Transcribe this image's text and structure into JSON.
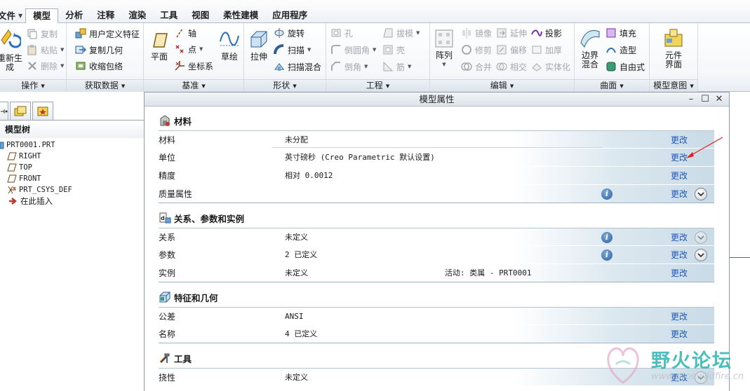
{
  "tabs": [
    {
      "label": "文件",
      "key": "file"
    },
    {
      "label": "模型",
      "key": "model"
    },
    {
      "label": "分析",
      "key": "analysis"
    },
    {
      "label": "注释",
      "key": "annotate"
    },
    {
      "label": "渲染",
      "key": "render"
    },
    {
      "label": "工具",
      "key": "tools"
    },
    {
      "label": "视图",
      "key": "view"
    },
    {
      "label": "柔性建模",
      "key": "flexible"
    },
    {
      "label": "应用程序",
      "key": "apps"
    }
  ],
  "ribbon": {
    "operations": {
      "regen": "重新生\n成",
      "copy": "复制",
      "paste": "粘贴",
      "delete": "删除",
      "label": "操作"
    },
    "get_data": {
      "udf": "用户定义特征",
      "copy_geom": "复制几何",
      "shrinkwrap": "收缩包络",
      "label": "获取数据"
    },
    "datum": {
      "plane": "平面",
      "axis": "轴",
      "point": "点",
      "csys": "坐标系",
      "sketch": "草绘",
      "label": "基准"
    },
    "shapes": {
      "extrude": "拉伸",
      "revolve": "旋转",
      "sweep": "扫描",
      "swept_blend": "扫描混合",
      "label": "形状"
    },
    "engineering": {
      "hole": "孔",
      "round": "倒圆角",
      "chamfer": "倒角",
      "draft": "拔模",
      "shell": "壳",
      "rib": "筋",
      "label": "工程"
    },
    "editing": {
      "pattern": "阵列",
      "mirror": "镜像",
      "trim": "修剪",
      "merge": "合并",
      "extend": "延伸",
      "offset": "偏移",
      "intersect": "相交",
      "project": "投影",
      "thicken": "加厚",
      "solidify": "实体化",
      "label": "编辑"
    },
    "surfaces": {
      "boundary_blend": "边界\n混合",
      "fill": "填充",
      "style": "造型",
      "freestyle": "自由式",
      "label": "曲面"
    },
    "model_intent": {
      "component_interface": "元件\n界面",
      "label": "模型意图"
    }
  },
  "left_panel": {
    "tree_title": "模型树",
    "nodes": [
      "PRT0001.PRT",
      "RIGHT",
      "TOP",
      "FRONT",
      "PRT_CSYS_DEF",
      "在此插入"
    ]
  },
  "dialog": {
    "title": "模型属性",
    "link_label": "更改",
    "sections": [
      {
        "title": "材料",
        "rows": [
          {
            "label": "材料",
            "value": "未分配"
          },
          {
            "label": "单位",
            "value": "英寸磅秒 (Creo Parametric 默认设置)"
          },
          {
            "label": "精度",
            "value": "相对 0.0012"
          },
          {
            "label": "质量属性",
            "value": ""
          }
        ]
      },
      {
        "title": "关系、参数和实例",
        "rows": [
          {
            "label": "关系",
            "value": "未定义"
          },
          {
            "label": "参数",
            "value": "2 已定义"
          },
          {
            "label": "实例",
            "value": "未定义",
            "extra": "活动: 类属 - PRT0001"
          }
        ]
      },
      {
        "title": "特征和几何",
        "rows": [
          {
            "label": "公差",
            "value": "ANSI"
          },
          {
            "label": "名称",
            "value": "4 已定义"
          }
        ]
      },
      {
        "title": "工具",
        "rows": [
          {
            "label": "挠性",
            "value": "未定义"
          }
        ]
      }
    ]
  },
  "watermark": {
    "text": "野火论坛",
    "url": "www.proewildfire.cn"
  },
  "colors": {
    "link": "#1f58b8",
    "row_gradient_end": "#c9dbe7",
    "annotation_arrow": "#e02020",
    "watermark": "#2db3b0"
  }
}
